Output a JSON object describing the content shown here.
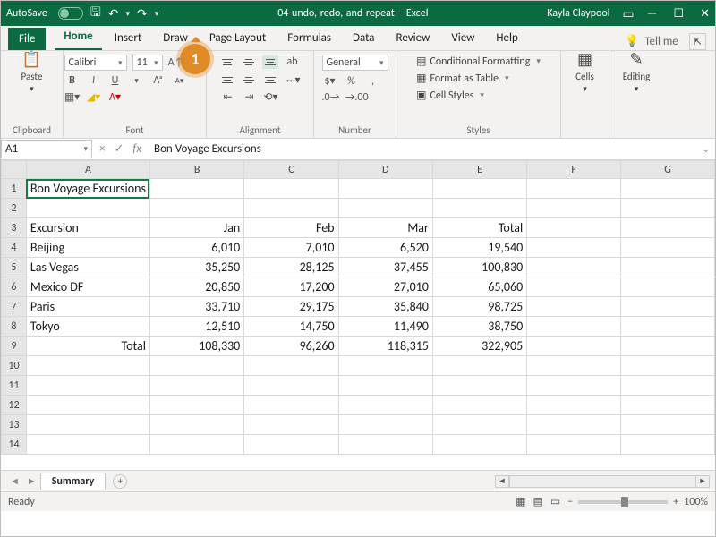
{
  "titlebar": {
    "autosave": "AutoSave",
    "docname": "04-undo,-redo,-and-repeat",
    "app": "Excel",
    "user": "Kayla Claypool"
  },
  "tabs": {
    "file": "File",
    "list": [
      "Home",
      "Insert",
      "Draw",
      "Page Layout",
      "Formulas",
      "Data",
      "Review",
      "View",
      "Help"
    ],
    "active": 0,
    "tellme": "Tell me"
  },
  "ribbon": {
    "clipboard": {
      "label": "Clipboard",
      "paste": "Paste"
    },
    "font": {
      "label": "Font",
      "name": "Calibri",
      "size": "11"
    },
    "alignment": {
      "label": "Alignment"
    },
    "number": {
      "label": "Number",
      "format": "General"
    },
    "styles": {
      "label": "Styles",
      "cond": "Conditional Formatting",
      "table": "Format as Table",
      "cell": "Cell Styles"
    },
    "cells": {
      "label": "Cells"
    },
    "editing": {
      "label": "Editing"
    }
  },
  "namebox": "A1",
  "formula": "Bon Voyage Excursions",
  "chart_data": {
    "type": "table",
    "title": "Bon Voyage Excursions",
    "columns": [
      "Excursion",
      "Jan",
      "Feb",
      "Mar",
      "Total"
    ],
    "rows": [
      {
        "label": "Beijing",
        "values": [
          "6,010",
          "7,010",
          "6,520",
          "19,540"
        ]
      },
      {
        "label": "Las Vegas",
        "values": [
          "35,250",
          "28,125",
          "37,455",
          "100,830"
        ]
      },
      {
        "label": "Mexico DF",
        "values": [
          "20,850",
          "17,200",
          "27,010",
          "65,060"
        ]
      },
      {
        "label": "Paris",
        "values": [
          "33,710",
          "29,175",
          "35,840",
          "98,725"
        ]
      },
      {
        "label": "Tokyo",
        "values": [
          "12,510",
          "14,750",
          "11,490",
          "38,750"
        ]
      }
    ],
    "totals": {
      "label": "Total",
      "values": [
        "108,330",
        "96,260",
        "118,315",
        "322,905"
      ]
    }
  },
  "cols": [
    "A",
    "B",
    "C",
    "D",
    "E",
    "F",
    "G"
  ],
  "sheet_tab": "Summary",
  "status": "Ready",
  "zoom": "100%",
  "callout": "1"
}
